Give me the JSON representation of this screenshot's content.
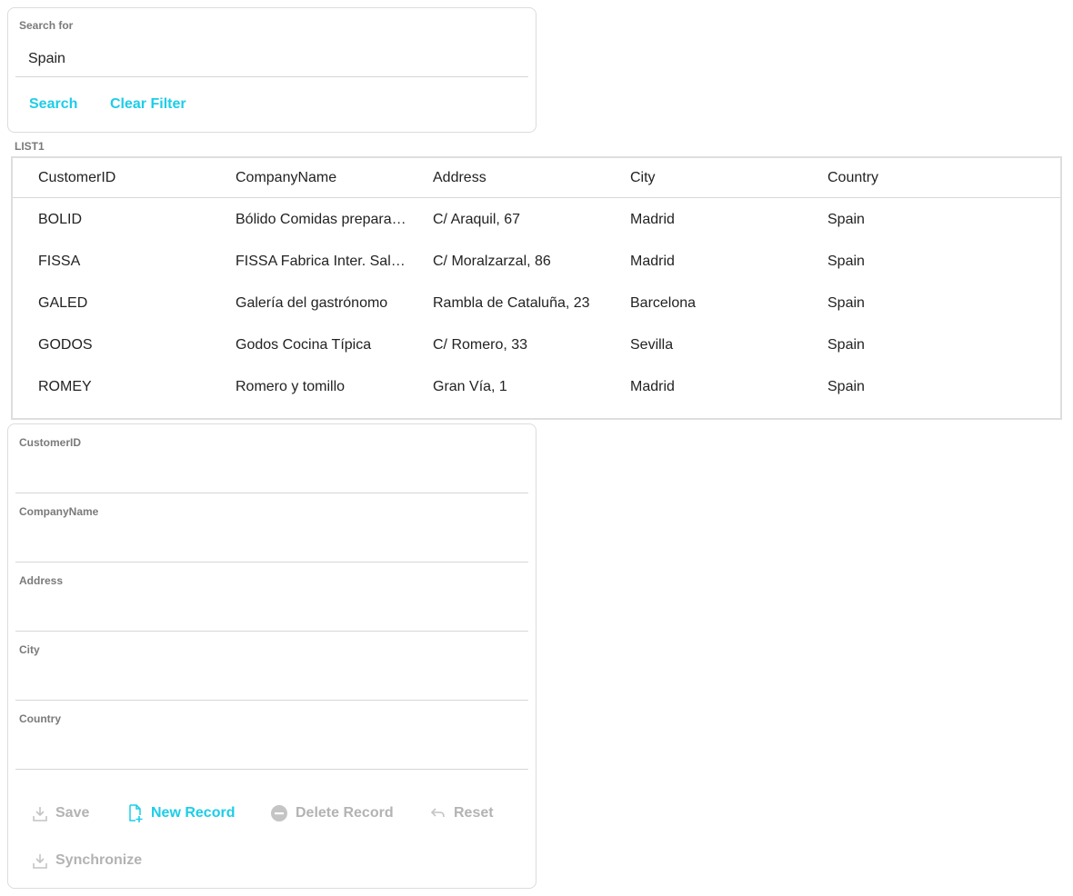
{
  "search": {
    "label": "Search for",
    "value": "Spain",
    "search_label": "Search",
    "clear_label": "Clear Filter"
  },
  "list": {
    "label": "LIST1",
    "columns": [
      "CustomerID",
      "CompanyName",
      "Address",
      "City",
      "Country"
    ],
    "rows": [
      [
        "BOLID",
        "Bólido Comidas preparadas",
        "C/ Araquil, 67",
        "Madrid",
        "Spain"
      ],
      [
        "FISSA",
        "FISSA Fabrica Inter. Salchichas S.A.",
        "C/ Moralzarzal, 86",
        "Madrid",
        "Spain"
      ],
      [
        "GALED",
        "Galería del gastrónomo",
        "Rambla de Cataluña, 23",
        "Barcelona",
        "Spain"
      ],
      [
        "GODOS",
        "Godos Cocina Típica",
        "C/ Romero, 33",
        "Sevilla",
        "Spain"
      ],
      [
        "ROMEY",
        "Romero y tomillo",
        "Gran Vía, 1",
        "Madrid",
        "Spain"
      ]
    ]
  },
  "form": {
    "fields": [
      {
        "label": "CustomerID",
        "value": ""
      },
      {
        "label": "CompanyName",
        "value": ""
      },
      {
        "label": "Address",
        "value": ""
      },
      {
        "label": "City",
        "value": ""
      },
      {
        "label": "Country",
        "value": ""
      }
    ],
    "actions": {
      "save": "Save",
      "new_record": "New Record",
      "delete_record": "Delete Record",
      "reset": "Reset",
      "synchronize": "Synchronize"
    }
  },
  "icons": {
    "save": "save-icon",
    "new_record": "new-document-icon",
    "delete_record": "minus-circle-icon",
    "reset": "undo-icon",
    "synchronize": "download-icon"
  },
  "colors": {
    "accent": "#1ccde8",
    "disabled": "#b3b3b3",
    "label": "#7a7a7a",
    "border": "#dcdcdc"
  }
}
